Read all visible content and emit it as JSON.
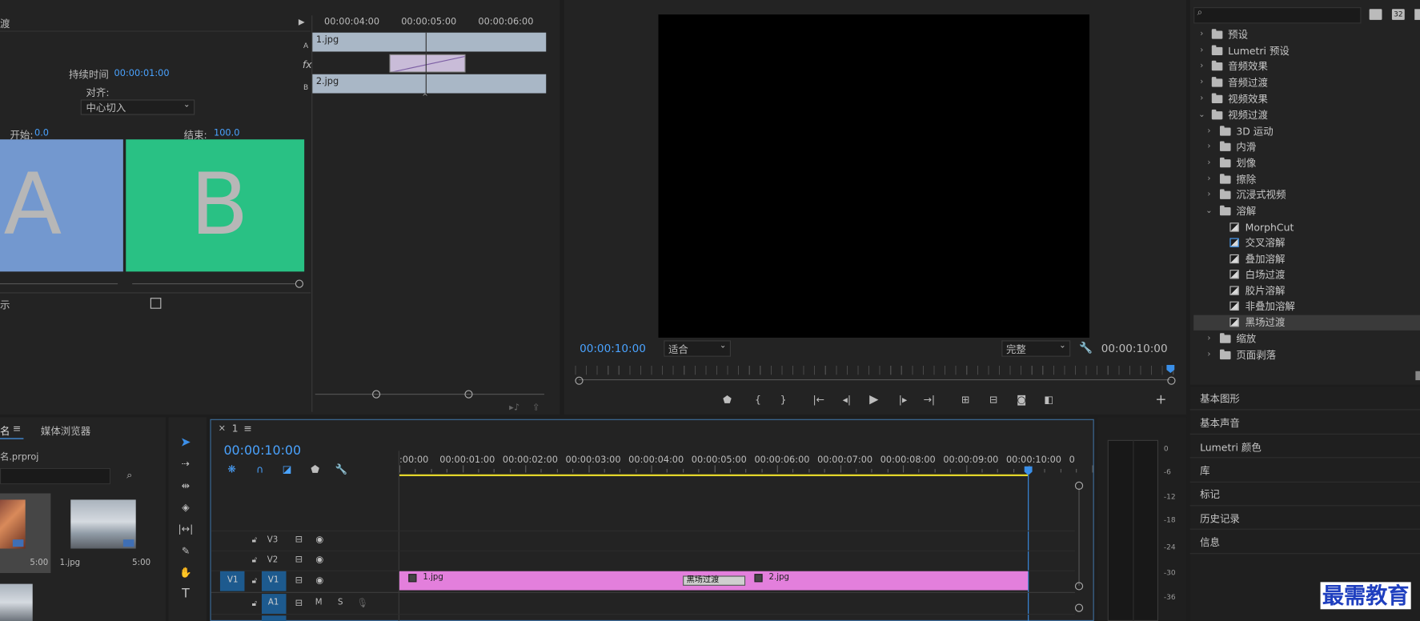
{
  "effect_controls": {
    "duration_label": "持续时间",
    "duration_value": "00:00:01:00",
    "align_label": "对齐:",
    "align_value": "中心切入",
    "start_label": "开始:",
    "start_value": "0.0",
    "end_label": "结束:",
    "end_value": "100.0",
    "thumb_a": "A",
    "thumb_b": "B",
    "track_a": "A",
    "track_b": "B",
    "fx": "fx",
    "clip_a": "1.jpg",
    "clip_b": "2.jpg",
    "ruler": [
      "00:00:04:00",
      "00:00:05:00",
      "00:00:06:00"
    ]
  },
  "program_monitor": {
    "timecode_left": "00:00:10:00",
    "fit_select": "适合",
    "quality_select": "完整",
    "timecode_right": "00:00:10:00"
  },
  "effects_panel": {
    "search_placeholder": "",
    "badge_1": "",
    "badge_2": "32",
    "items": [
      {
        "label": "预设"
      },
      {
        "label": "Lumetri 预设"
      },
      {
        "label": "音频效果"
      },
      {
        "label": "音频过渡"
      },
      {
        "label": "视频效果"
      },
      {
        "label": "视频过渡"
      },
      {
        "label": "3D 运动"
      },
      {
        "label": "内滑"
      },
      {
        "label": "划像"
      },
      {
        "label": "擦除"
      },
      {
        "label": "沉浸式视频"
      },
      {
        "label": "溶解"
      },
      {
        "label": "MorphCut"
      },
      {
        "label": "交叉溶解"
      },
      {
        "label": "叠加溶解"
      },
      {
        "label": "白场过渡"
      },
      {
        "label": "胶片溶解"
      },
      {
        "label": "非叠加溶解"
      },
      {
        "label": "黑场过渡"
      },
      {
        "label": "缩放"
      },
      {
        "label": "页面剥落"
      }
    ]
  },
  "side_panels": [
    "基本图形",
    "基本声音",
    "Lumetri 颜色",
    "库",
    "标记",
    "历史记录",
    "信息"
  ],
  "project_panel": {
    "tab_name": "名",
    "tab_media_browser": "媒体浏览器",
    "project_file": "名.prproj",
    "item1_duration": "5:00",
    "item2_name": "1.jpg",
    "item2_duration": "5:00"
  },
  "timeline": {
    "tab_close": "×",
    "tab_name": "1",
    "timecode": "00:00:10:00",
    "ruler": [
      ":00:00",
      "00:00:01:00",
      "00:00:02:00",
      "00:00:03:00",
      "00:00:04:00",
      "00:00:05:00",
      "00:00:06:00",
      "00:00:07:00",
      "00:00:08:00",
      "00:00:09:00",
      "00:00:10:00",
      "0"
    ],
    "tracks": {
      "v3": "V3",
      "v2": "V2",
      "v1_src": "V1",
      "v1": "V1",
      "a1": "A1",
      "m": "M",
      "s": "S"
    },
    "clip1": "1.jpg",
    "transition": "黑场过渡",
    "clip2": "2.jpg"
  },
  "audio_meter": {
    "labels": [
      "0",
      "-6",
      "-12",
      "-18",
      "-24",
      "-30",
      "-36"
    ]
  },
  "watermark": "最需教育",
  "colors": {
    "accent_blue": "#4aa3ff",
    "clip_pink": "#e37fdc",
    "thumb_a": "#7398cf",
    "thumb_b": "#29c184",
    "clip_slate": "#a9b7c6"
  }
}
